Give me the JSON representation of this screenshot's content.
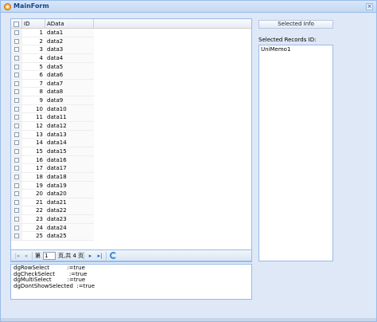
{
  "window": {
    "title": "MainForm"
  },
  "grid": {
    "columns": [
      "ID",
      "AData"
    ],
    "rows": [
      {
        "id": "1",
        "adata": "data1"
      },
      {
        "id": "2",
        "adata": "data2"
      },
      {
        "id": "3",
        "adata": "data3"
      },
      {
        "id": "4",
        "adata": "data4"
      },
      {
        "id": "5",
        "adata": "data5"
      },
      {
        "id": "6",
        "adata": "data6"
      },
      {
        "id": "7",
        "adata": "data7"
      },
      {
        "id": "8",
        "adata": "data8"
      },
      {
        "id": "9",
        "adata": "data9"
      },
      {
        "id": "10",
        "adata": "data10"
      },
      {
        "id": "11",
        "adata": "data11"
      },
      {
        "id": "12",
        "adata": "data12"
      },
      {
        "id": "13",
        "adata": "data13"
      },
      {
        "id": "14",
        "adata": "data14"
      },
      {
        "id": "15",
        "adata": "data15"
      },
      {
        "id": "16",
        "adata": "data16"
      },
      {
        "id": "17",
        "adata": "data17"
      },
      {
        "id": "18",
        "adata": "data18"
      },
      {
        "id": "19",
        "adata": "data19"
      },
      {
        "id": "20",
        "adata": "data20"
      },
      {
        "id": "21",
        "adata": "data21"
      },
      {
        "id": "22",
        "adata": "data22"
      },
      {
        "id": "23",
        "adata": "data23"
      },
      {
        "id": "24",
        "adata": "data24"
      },
      {
        "id": "25",
        "adata": "data25"
      }
    ]
  },
  "pager": {
    "page_prefix": "第",
    "page_value": "1",
    "page_suffix": "页,共 4 页"
  },
  "options": [
    "dgRowSelect          :=true",
    "dgCheckSelect        :=true",
    "dgMultiSelect         :=true",
    "dgDontShowSelected  :=true"
  ],
  "right": {
    "button_label": "Selected Info",
    "records_label": "Selected Records ID:",
    "memo_text": "UniMemo1"
  }
}
